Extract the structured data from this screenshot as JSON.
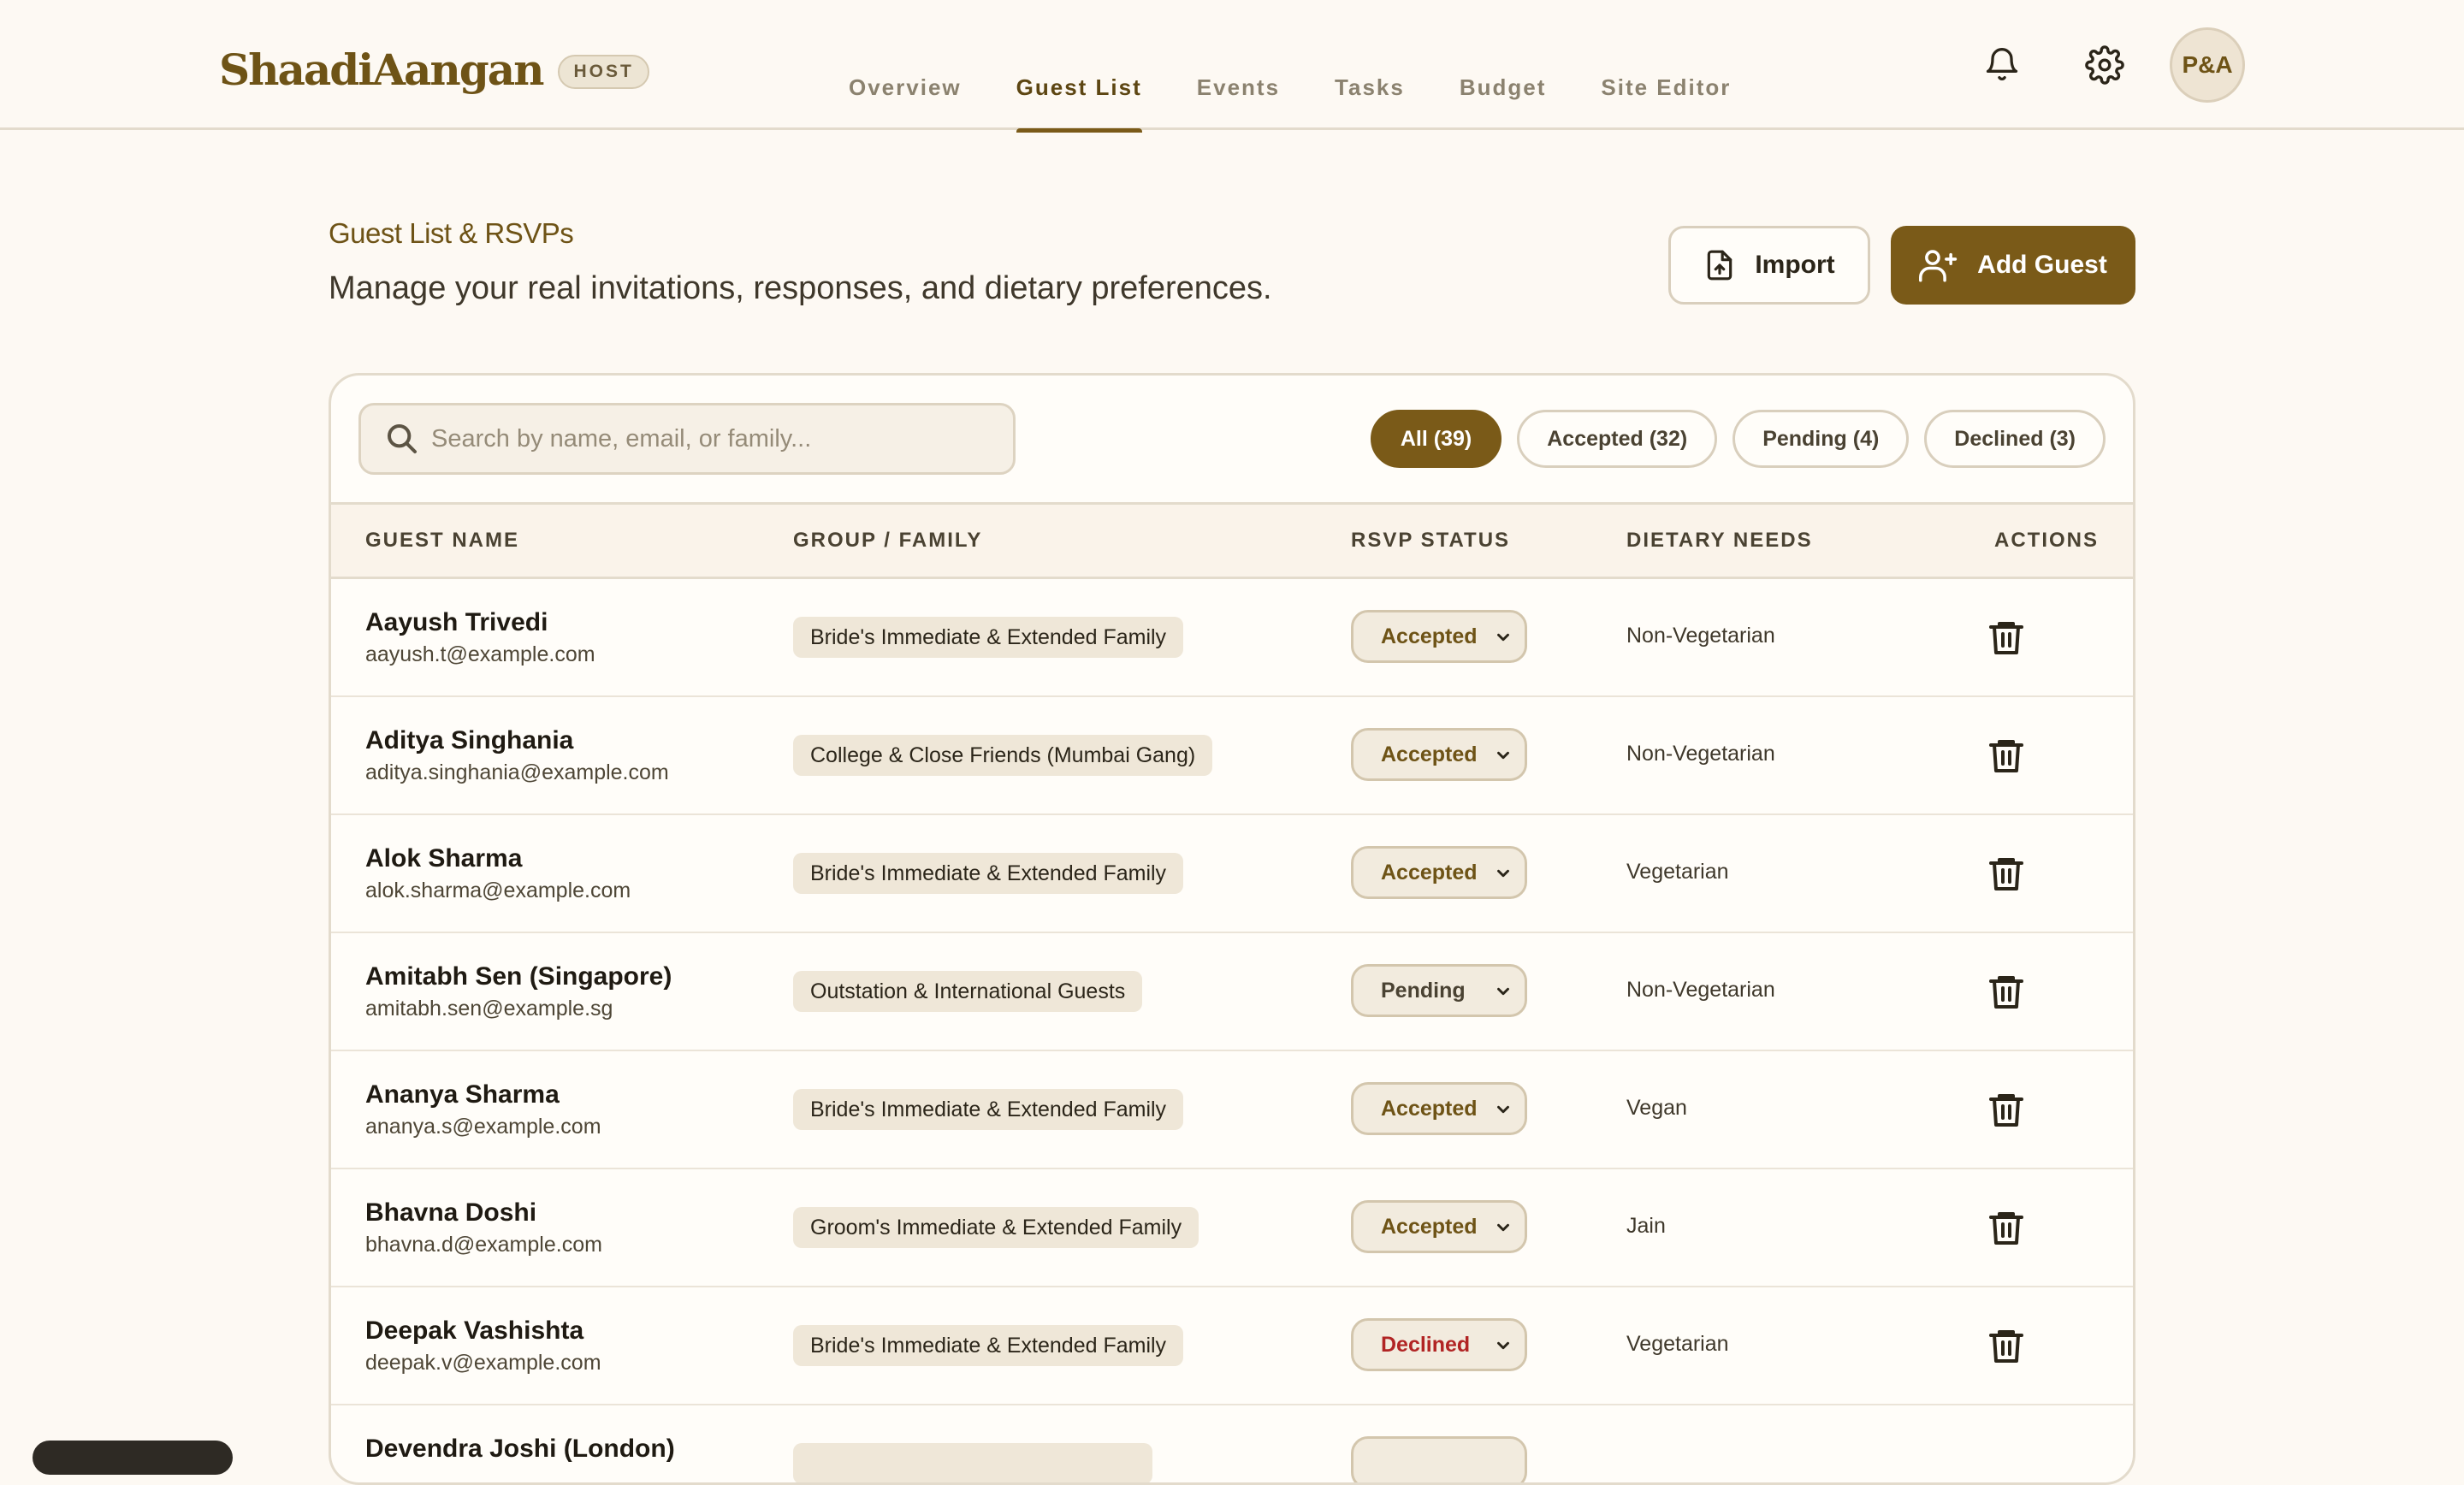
{
  "app": {
    "brand": "ShaadiAangan",
    "role_badge": "HOST",
    "avatar_initials": "P&A"
  },
  "nav": {
    "tabs": [
      {
        "label": "Overview"
      },
      {
        "label": "Guest List"
      },
      {
        "label": "Events"
      },
      {
        "label": "Tasks"
      },
      {
        "label": "Budget"
      },
      {
        "label": "Site Editor"
      }
    ],
    "active": "Guest List"
  },
  "header_icons": [
    "bell-icon",
    "gear-icon"
  ],
  "page": {
    "title": "Guest List & RSVPs",
    "subtitle": "Manage your real invitations, responses, and dietary preferences.",
    "import_label": "Import",
    "add_label": "Add Guest"
  },
  "search": {
    "placeholder": "Search by name, email, or family...",
    "value": ""
  },
  "filters": [
    {
      "label": "All (39)",
      "active": true
    },
    {
      "label": "Accepted (32)",
      "active": false
    },
    {
      "label": "Pending (4)",
      "active": false
    },
    {
      "label": "Declined (3)",
      "active": false
    }
  ],
  "table": {
    "columns": [
      "GUEST NAME",
      "GROUP / FAMILY",
      "RSVP STATUS",
      "DIETARY NEEDS",
      "ACTIONS"
    ],
    "rows": [
      {
        "name": "Aayush Trivedi",
        "email": "aayush.t@example.com",
        "group": "Bride's Immediate & Extended Family",
        "rsvp": "Accepted",
        "diet": "Non-Vegetarian"
      },
      {
        "name": "Aditya Singhania",
        "email": "aditya.singhania@example.com",
        "group": "College & Close Friends (Mumbai Gang)",
        "rsvp": "Accepted",
        "diet": "Non-Vegetarian"
      },
      {
        "name": "Alok Sharma",
        "email": "alok.sharma@example.com",
        "group": "Bride's Immediate & Extended Family",
        "rsvp": "Accepted",
        "diet": "Vegetarian"
      },
      {
        "name": "Amitabh Sen (Singapore)",
        "email": "amitabh.sen@example.sg",
        "group": "Outstation & International Guests",
        "rsvp": "Pending",
        "diet": "Non-Vegetarian"
      },
      {
        "name": "Ananya Sharma",
        "email": "ananya.s@example.com",
        "group": "Bride's Immediate & Extended Family",
        "rsvp": "Accepted",
        "diet": "Vegan"
      },
      {
        "name": "Bhavna Doshi",
        "email": "bhavna.d@example.com",
        "group": "Groom's Immediate & Extended Family",
        "rsvp": "Accepted",
        "diet": "Jain"
      },
      {
        "name": "Deepak Vashishta",
        "email": "deepak.v@example.com",
        "group": "Bride's Immediate & Extended Family",
        "rsvp": "Declined",
        "diet": "Vegetarian"
      },
      {
        "name": "Devendra Joshi (London)",
        "email": "",
        "group": "",
        "rsvp": "",
        "diet": ""
      }
    ]
  },
  "colors": {
    "accent": "#7a5a18",
    "background": "#fdf9f3",
    "declined": "#b12424"
  }
}
